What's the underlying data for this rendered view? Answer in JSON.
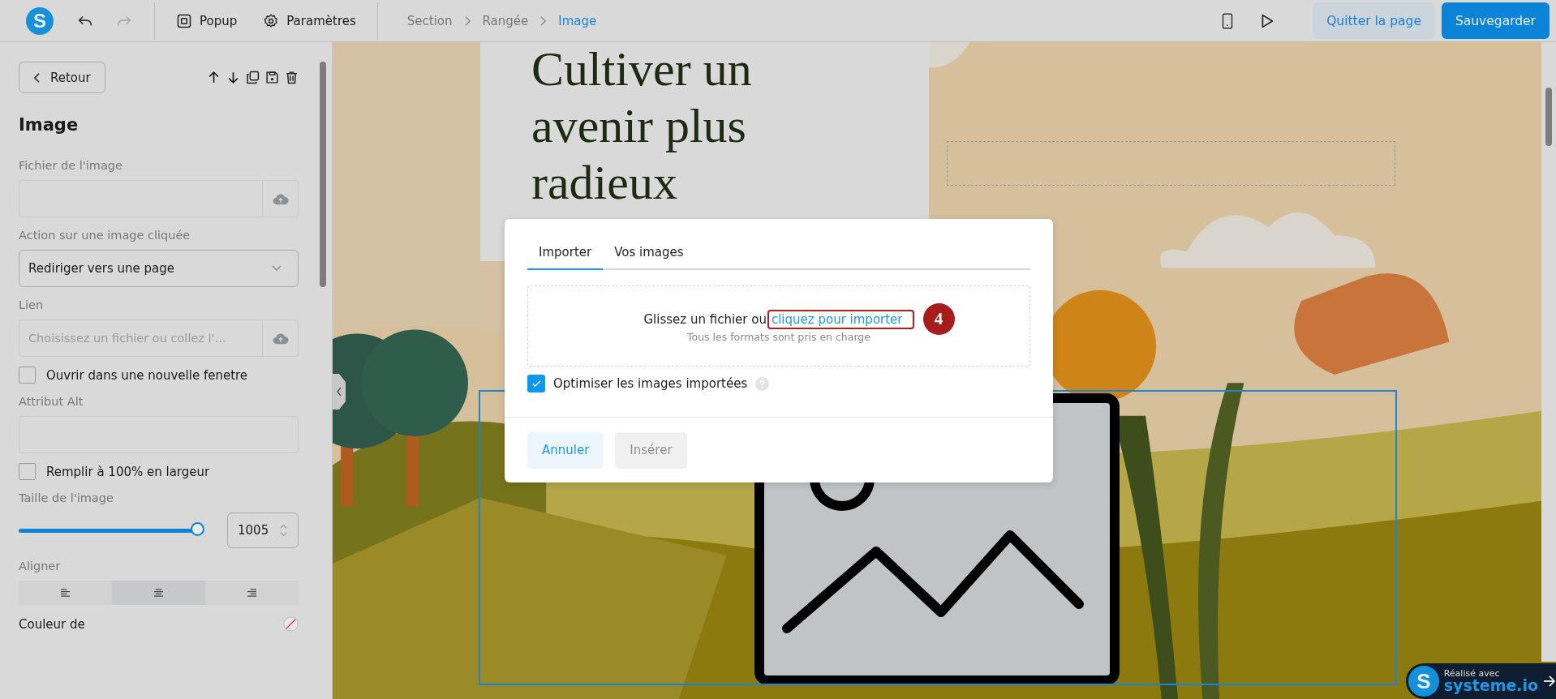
{
  "topbar": {
    "logo": "S",
    "tools": [
      {
        "kind": "popup",
        "label": "Popup"
      },
      {
        "kind": "settings",
        "label": "Paramètres"
      }
    ],
    "breadcrumb": [
      {
        "label": "Section",
        "selected": false
      },
      {
        "label": "Rangée",
        "selected": false
      },
      {
        "label": "Image",
        "selected": true
      }
    ],
    "actions": [
      {
        "kind": "secondary",
        "label": "Quitter la page"
      },
      {
        "kind": "primary",
        "label": "Sauvegarder"
      }
    ]
  },
  "panel": {
    "back": "Retour",
    "title": "Image",
    "fields": [
      {
        "kind": "upload",
        "label": "Fichier de l'image"
      },
      {
        "kind": "select",
        "label": "Action sur une image cliquée",
        "value": "Rediriger vers une page"
      },
      {
        "kind": "upload",
        "label": "Lien",
        "placeholder": "Choisissez un fichier ou collez l'..."
      },
      {
        "kind": "checkbox",
        "label": "Ouvrir dans une nouvelle fenetre",
        "checked": false
      },
      {
        "kind": "text",
        "label": "Attribut Alt"
      },
      {
        "kind": "checkbox",
        "label": "Remplir à 100% en largeur",
        "checked": false
      },
      {
        "kind": "slider",
        "label": "Taille de l'image",
        "level": 0.97,
        "value": "1005"
      },
      {
        "kind": "align",
        "label": "Aligner",
        "options": [
          {
            "selected": false
          },
          {
            "selected": true
          },
          {
            "selected": false
          }
        ]
      },
      {
        "kind": "color",
        "label": "Couleur de"
      }
    ]
  },
  "canvas": {
    "heading": "Cultiver un avenir plus radieux"
  },
  "modal": {
    "tabs": [
      {
        "label": "Importer",
        "selected": true
      },
      {
        "label": "Vos images",
        "selected": false
      }
    ],
    "drop_text": "Glissez un fichier ou",
    "drop_link": "cliquez pour importer",
    "step_marker": "4",
    "hint": "Tous les formats sont pris en charge",
    "option": {
      "label": "Optimiser les images importées",
      "checked": true
    },
    "buttons": [
      {
        "label": "Annuler",
        "disabled": false
      },
      {
        "label": "Insérer",
        "disabled": true
      }
    ]
  },
  "badge": {
    "logo": "S",
    "line1": "Réalisé avec",
    "line2": "systeme.io"
  }
}
